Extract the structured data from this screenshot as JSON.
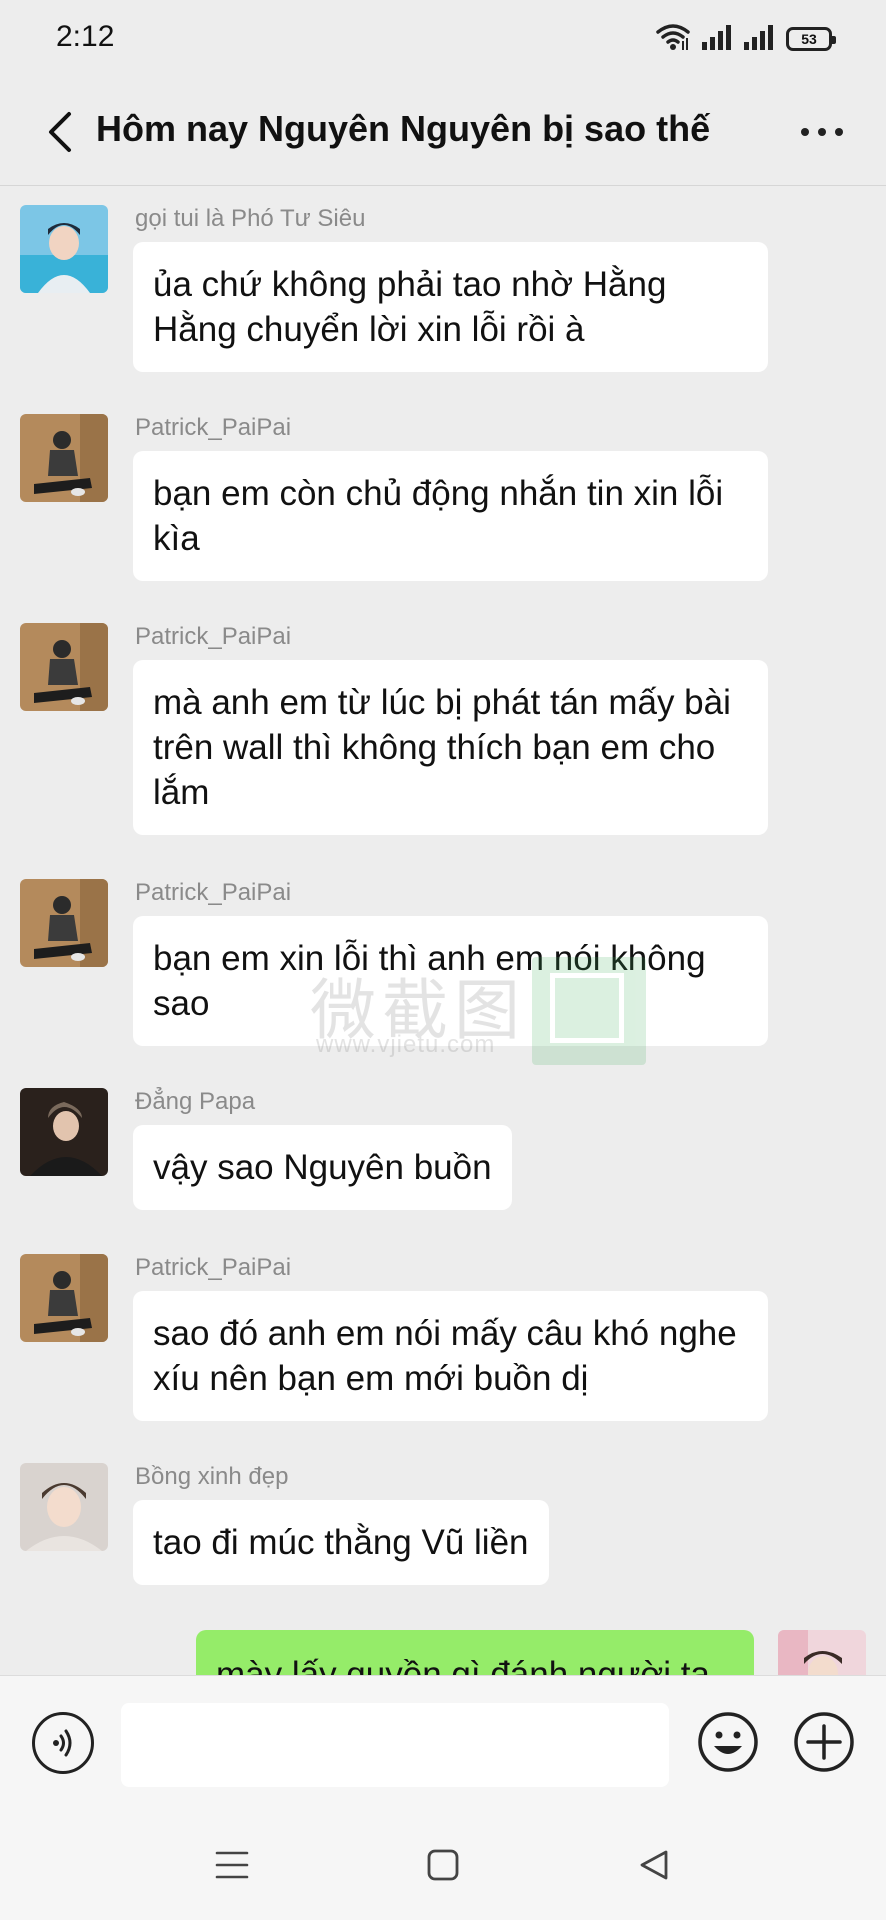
{
  "status_bar": {
    "time": "2:12",
    "battery": "53"
  },
  "header": {
    "title": "Hôm nay Nguyên Nguyên bị sao thế"
  },
  "watermark": {
    "text": "微截图",
    "url": "www.vjietu.com"
  },
  "messages": [
    {
      "sender": "gọi tui là Phó Tư Siêu",
      "text": "ủa chứ không phải tao nhờ Hằng Hằng chuyển lời xin lỗi rồi à"
    },
    {
      "sender": "Patrick_PaiPai",
      "text": "bạn em còn chủ động nhắn tin xin lỗi kìa"
    },
    {
      "sender": "Patrick_PaiPai",
      "text": "mà anh em từ lúc bị phát tán mấy bài trên wall thì không thích bạn em cho lắm"
    },
    {
      "sender": "Patrick_PaiPai",
      "text": "bạn em xin lỗi thì anh em nói không sao"
    },
    {
      "sender": "Đẳng Papa",
      "text": "vậy sao Nguyên buồn"
    },
    {
      "sender": "Patrick_PaiPai",
      "text": "sao đó anh em nói mấy câu khó nghe xíu nên bạn em mới buồn dị"
    },
    {
      "sender": "Bồng xinh đẹp",
      "text": "tao đi múc thằng Vũ liền"
    }
  ],
  "outgoing": {
    "text": "mày lấy quyền gì đánh người ta"
  },
  "input": {
    "value": ""
  },
  "colors": {
    "background": "#ededed",
    "outgoing_bubble": "#95ec69",
    "incoming_bubble": "#ffffff"
  },
  "icons": {
    "back": "chevron-left-icon",
    "more": "more-horizontal-icon",
    "voice": "voice-icon",
    "emoji": "emoji-icon",
    "plus": "plus-circle-icon",
    "menu": "menu-icon",
    "home": "square-icon",
    "nav_back": "triangle-back-icon"
  }
}
